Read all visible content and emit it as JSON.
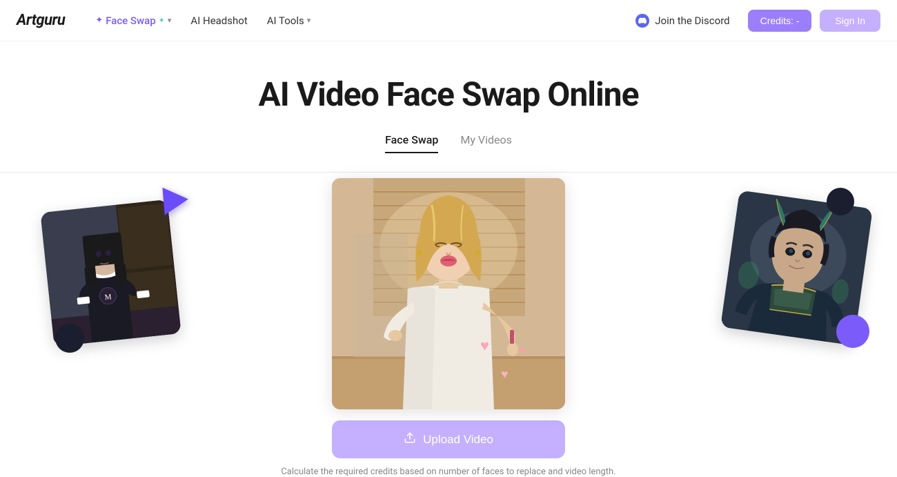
{
  "brand": {
    "logo": "Artguru"
  },
  "nav": {
    "faceswap_label": "Face Swap",
    "headshot_label": "AI Headshot",
    "aitools_label": "AI Tools",
    "discord_label": "Join the Discord",
    "credits_label": "Credits: -",
    "signin_label": "Sign In"
  },
  "page": {
    "title": "AI Video Face Swap Online",
    "tab_faceswap": "Face Swap",
    "tab_myvideos": "My Videos",
    "upload_btn": "Upload Video",
    "upload_caption": "Calculate the required credits based on number of faces to replace and video length."
  },
  "icons": {
    "play": "▶",
    "discord": "⬡",
    "upload": "⟳",
    "sparkle": "✦",
    "sparkle_teal": "✦",
    "chevron": "▾"
  }
}
